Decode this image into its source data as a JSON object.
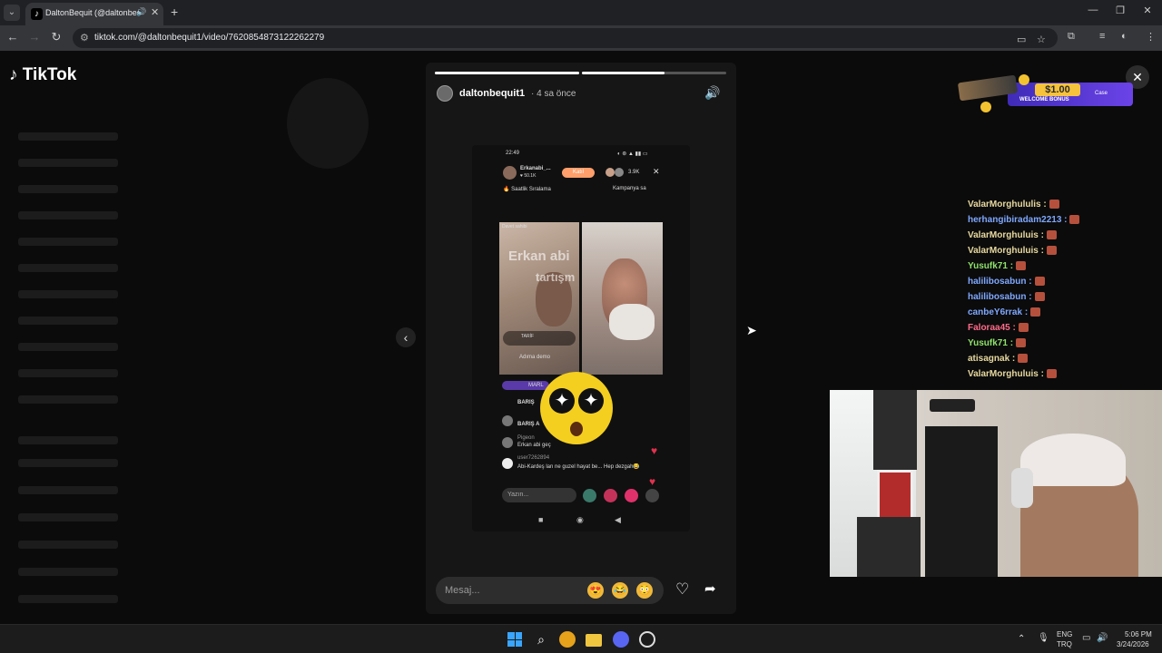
{
  "browser": {
    "tab_title": "DaltonBequit (@daltonbeq",
    "tab_favicon": "♪",
    "url": "tiktok.com/@daltonbequit1/video/7620854873122262279"
  },
  "page": {
    "logo_text": "TikTok"
  },
  "story": {
    "username": "daltonbequit1",
    "time_ago": "· 4 sa önce",
    "progress": [
      1.0,
      0.57
    ],
    "message_placeholder": "Mesaj...",
    "quick_emojis": [
      "😍",
      "😂",
      "😳"
    ]
  },
  "phone": {
    "status_time": "22:49",
    "host_name": "Erkanabi_...",
    "host_followers": "♥ 50.1K",
    "follow_label": "Katıl",
    "viewer_count": "3.9K",
    "ranking_label": "🔥 Saatlik Sıralama",
    "campaign_label": "Kampanya sa",
    "left_tag": "Davet sahibi",
    "overlay_text_1": "Erkan abi",
    "overlay_text_2": "tartışm",
    "tarif_label": "TARİF",
    "adima_label": "Adıma demo",
    "chat": [
      {
        "name": "MARL",
        "text": ""
      },
      {
        "name": "BARIŞ",
        "text": ""
      },
      {
        "name": "BARIŞ A",
        "text": ""
      },
      {
        "name": "Pigeon",
        "text": "Erkan abi geç"
      },
      {
        "name": "user7262894",
        "text": "Abi-Kardeş lan ne guzel hayat be... Hep dezgah😂"
      }
    ],
    "input_placeholder": "Yazın..."
  },
  "stream_chat": [
    {
      "user": "ValarMorghululis",
      "color": "#e8d9a0"
    },
    {
      "user": "herhangibiradam2213",
      "color": "#7fa8ff"
    },
    {
      "user": "ValarMorghuluis",
      "color": "#e8d9a0"
    },
    {
      "user": "ValarMorghuluis",
      "color": "#e8d9a0"
    },
    {
      "user": "Yusufk71",
      "color": "#8fe36b"
    },
    {
      "user": "halilibosabun",
      "color": "#7fa8ff"
    },
    {
      "user": "halilibosabun",
      "color": "#7fa8ff"
    },
    {
      "user": "canbeY6rrak",
      "color": "#7fa8ff"
    },
    {
      "user": "Faloraa45",
      "color": "#ff6b8a"
    },
    {
      "user": "Yusufk71",
      "color": "#8fe36b"
    },
    {
      "user": "atisagnak",
      "color": "#e8d9a0"
    },
    {
      "user": "ValarMorghuluis",
      "color": "#e8d9a0"
    }
  ],
  "promo": {
    "amount": "$1.00",
    "label": "WELCOME BONUS",
    "brand": "Case"
  },
  "taskbar": {
    "lang_top": "ENG",
    "lang_bottom": "TRQ",
    "time": "5:06 PM",
    "date": "3/24/2026"
  }
}
